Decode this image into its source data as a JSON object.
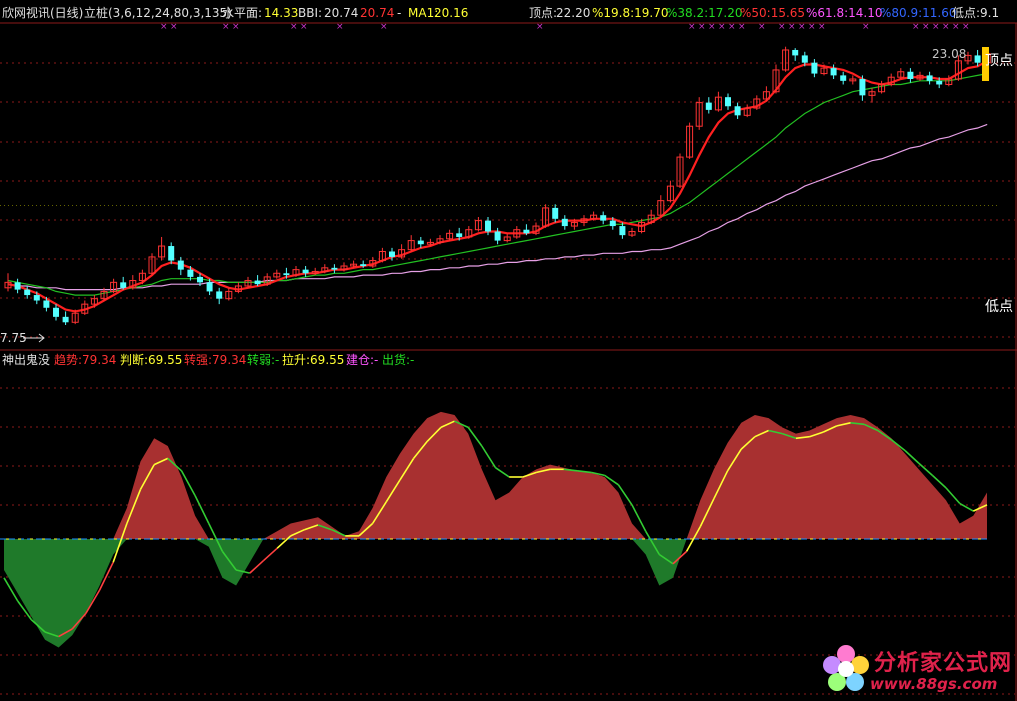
{
  "header_main": {
    "title": "欣网视讯(日线)",
    "indicator": "立桩(3,6,12,24,80,3,135)",
    "level_label": "水平面:",
    "level_value": "14.33",
    "bbi_label": "BBI:",
    "bbi_value": "20.74",
    "bbi_value2": "20.74",
    "dash": "-",
    "ma_label": "MA1:",
    "ma_value": "20.16",
    "top_label": "顶点:",
    "top_value": "22.20",
    "fib1": "%19.8:19.70",
    "fib2": "%38.2:17.20",
    "fib3": "%50:15.65",
    "fib4": "%61.8:14.10",
    "fib5": "%80.9:11.60",
    "low_label": "低点:",
    "low_value": "9.1"
  },
  "header_sub": {
    "name": "神出鬼没",
    "trend": "趋势:79.34",
    "judge": "判断:69.55",
    "strong": "转强:79.34",
    "weak": "转弱:-",
    "pull": "拉升:69.55",
    "build": "建仓:-",
    "ship": "出货:-"
  },
  "annotations": {
    "high_price": "23.08",
    "low_price": "7.75",
    "top_mark": "顶点",
    "low_mark": "低点"
  },
  "watermark": {
    "brand": "分析家公式网",
    "url": "www.88gs.com"
  },
  "colors": {
    "up": "#ff3333",
    "down": "#54ffff",
    "ma_short": "#ff2020",
    "ma_mid": "#22c022",
    "ma_long": "#e6a0e6",
    "level": "#ffff00",
    "osc_pos": "#a83030",
    "osc_neg": "#1f7a2a",
    "osc_line": "#ffff33",
    "zero_line": "#1e90ff",
    "grid": "#8b1a1a"
  },
  "chart_data": [
    {
      "type": "candlestick",
      "title": "欣网视讯(日线)",
      "ylim": [
        7.2,
        24.0
      ],
      "candles": [
        [
          9.8,
          10.1,
          10.6,
          9.6
        ],
        [
          10.1,
          9.7,
          10.3,
          9.5
        ],
        [
          9.7,
          9.4,
          9.9,
          9.2
        ],
        [
          9.4,
          9.1,
          9.6,
          8.9
        ],
        [
          9.1,
          8.7,
          9.3,
          8.5
        ],
        [
          8.7,
          8.2,
          8.9,
          8.0
        ],
        [
          8.2,
          7.9,
          8.5,
          7.75
        ],
        [
          7.9,
          8.4,
          8.6,
          7.8
        ],
        [
          8.4,
          8.9,
          9.1,
          8.3
        ],
        [
          8.9,
          9.2,
          9.4,
          8.7
        ],
        [
          9.2,
          9.6,
          9.8,
          9.1
        ],
        [
          9.6,
          10.1,
          10.3,
          9.5
        ],
        [
          10.1,
          9.8,
          10.4,
          9.7
        ],
        [
          9.8,
          10.2,
          10.5,
          9.7
        ],
        [
          10.2,
          10.6,
          10.8,
          10.0
        ],
        [
          10.6,
          11.5,
          11.7,
          10.5
        ],
        [
          11.5,
          12.1,
          12.6,
          11.3
        ],
        [
          12.1,
          11.3,
          12.3,
          11.1
        ],
        [
          11.3,
          10.8,
          11.5,
          10.5
        ],
        [
          10.8,
          10.4,
          11.0,
          10.2
        ],
        [
          10.4,
          10.1,
          10.6,
          9.9
        ],
        [
          10.1,
          9.6,
          10.3,
          9.4
        ],
        [
          9.6,
          9.2,
          9.8,
          8.9
        ],
        [
          9.2,
          9.6,
          9.8,
          9.1
        ],
        [
          9.6,
          9.9,
          10.1,
          9.5
        ],
        [
          9.9,
          10.2,
          10.4,
          9.8
        ],
        [
          10.2,
          10.0,
          10.5,
          9.9
        ],
        [
          10.0,
          10.4,
          10.6,
          9.9
        ],
        [
          10.4,
          10.6,
          10.8,
          10.3
        ],
        [
          10.6,
          10.5,
          10.9,
          10.3
        ],
        [
          10.5,
          10.8,
          11.0,
          10.4
        ],
        [
          10.8,
          10.6,
          11.0,
          10.4
        ],
        [
          10.6,
          10.7,
          10.9,
          10.5
        ],
        [
          10.7,
          10.9,
          11.1,
          10.6
        ],
        [
          10.9,
          10.8,
          11.1,
          10.6
        ],
        [
          10.8,
          11.0,
          11.2,
          10.7
        ],
        [
          11.0,
          11.1,
          11.3,
          10.9
        ],
        [
          11.1,
          11.0,
          11.3,
          10.9
        ],
        [
          11.0,
          11.3,
          11.5,
          10.9
        ],
        [
          11.3,
          11.8,
          12.0,
          11.2
        ],
        [
          11.8,
          11.5,
          12.0,
          11.3
        ],
        [
          11.5,
          11.9,
          12.2,
          11.4
        ],
        [
          11.9,
          12.4,
          12.7,
          11.8
        ],
        [
          12.4,
          12.2,
          12.6,
          12.0
        ],
        [
          12.2,
          12.3,
          12.5,
          12.1
        ],
        [
          12.3,
          12.5,
          12.7,
          12.2
        ],
        [
          12.5,
          12.8,
          13.0,
          12.4
        ],
        [
          12.8,
          12.6,
          13.1,
          12.4
        ],
        [
          12.6,
          13.0,
          13.2,
          12.5
        ],
        [
          13.0,
          13.5,
          13.7,
          12.9
        ],
        [
          13.5,
          12.9,
          13.7,
          12.7
        ],
        [
          12.9,
          12.4,
          13.1,
          12.2
        ],
        [
          12.4,
          12.6,
          12.8,
          12.3
        ],
        [
          12.6,
          13.0,
          13.2,
          12.5
        ],
        [
          13.0,
          12.8,
          13.3,
          12.7
        ],
        [
          12.8,
          13.2,
          13.4,
          12.7
        ],
        [
          13.2,
          14.2,
          14.4,
          13.1
        ],
        [
          14.2,
          13.6,
          14.4,
          13.4
        ],
        [
          13.6,
          13.2,
          13.8,
          13.0
        ],
        [
          13.2,
          13.4,
          13.6,
          13.0
        ],
        [
          13.4,
          13.6,
          13.8,
          13.2
        ],
        [
          13.6,
          13.8,
          14.0,
          13.5
        ],
        [
          13.8,
          13.5,
          14.0,
          13.3
        ],
        [
          13.5,
          13.2,
          13.7,
          13.0
        ],
        [
          13.2,
          12.7,
          13.4,
          12.5
        ],
        [
          12.7,
          12.9,
          13.1,
          12.6
        ],
        [
          12.9,
          13.4,
          13.6,
          12.8
        ],
        [
          13.4,
          13.8,
          14.1,
          13.3
        ],
        [
          13.8,
          14.6,
          14.9,
          13.7
        ],
        [
          14.6,
          15.4,
          15.7,
          14.5
        ],
        [
          15.4,
          17.0,
          17.2,
          15.3
        ],
        [
          17.0,
          18.7,
          18.9,
          16.9
        ],
        [
          18.7,
          20.0,
          20.3,
          18.5
        ],
        [
          20.0,
          19.6,
          20.3,
          19.4
        ],
        [
          19.6,
          20.3,
          20.6,
          19.5
        ],
        [
          20.3,
          19.8,
          20.5,
          19.6
        ],
        [
          19.8,
          19.3,
          20.0,
          19.1
        ],
        [
          19.3,
          19.7,
          19.9,
          19.2
        ],
        [
          19.7,
          20.2,
          20.4,
          19.6
        ],
        [
          20.2,
          20.6,
          20.9,
          20.1
        ],
        [
          20.6,
          21.8,
          22.1,
          20.5
        ],
        [
          21.8,
          22.9,
          23.08,
          21.7
        ],
        [
          22.9,
          22.6,
          23.0,
          22.3
        ],
        [
          22.6,
          22.2,
          22.8,
          22.0
        ],
        [
          22.2,
          21.6,
          22.4,
          21.4
        ],
        [
          21.6,
          21.9,
          22.1,
          21.5
        ],
        [
          21.9,
          21.5,
          22.1,
          21.3
        ],
        [
          21.5,
          21.2,
          21.7,
          21.0
        ],
        [
          21.2,
          21.3,
          21.5,
          21.0
        ],
        [
          21.3,
          20.4,
          21.5,
          20.1
        ],
        [
          20.4,
          20.6,
          20.8,
          20.0
        ],
        [
          20.6,
          21.0,
          21.2,
          20.5
        ],
        [
          21.0,
          21.4,
          21.6,
          20.9
        ],
        [
          21.4,
          21.7,
          21.9,
          21.3
        ],
        [
          21.7,
          21.3,
          21.9,
          21.1
        ],
        [
          21.3,
          21.5,
          21.7,
          21.2
        ],
        [
          21.5,
          21.2,
          21.7,
          21.0
        ],
        [
          21.2,
          21.0,
          21.4,
          20.8
        ],
        [
          21.0,
          21.3,
          21.5,
          20.9
        ],
        [
          21.3,
          22.3,
          22.6,
          21.2
        ],
        [
          22.3,
          22.6,
          22.8,
          22.1
        ],
        [
          22.6,
          22.2,
          22.9,
          22.0
        ],
        [
          22.2,
          22.7,
          23.0,
          22.1
        ]
      ],
      "ma_short": [
        10.0,
        9.9,
        9.7,
        9.5,
        9.2,
        8.9,
        8.6,
        8.5,
        8.6,
        8.8,
        9.1,
        9.4,
        9.7,
        9.9,
        10.1,
        10.5,
        11.0,
        11.2,
        11.1,
        10.9,
        10.6,
        10.3,
        10.0,
        9.8,
        9.7,
        9.8,
        9.9,
        10.0,
        10.2,
        10.4,
        10.5,
        10.6,
        10.6,
        10.7,
        10.8,
        10.8,
        10.9,
        11.0,
        11.1,
        11.3,
        11.5,
        11.6,
        11.8,
        12.0,
        12.1,
        12.3,
        12.4,
        12.5,
        12.6,
        12.8,
        12.9,
        12.9,
        12.8,
        12.8,
        12.8,
        12.9,
        13.2,
        13.4,
        13.5,
        13.5,
        13.5,
        13.6,
        13.6,
        13.6,
        13.4,
        13.3,
        13.2,
        13.4,
        13.7,
        14.2,
        15.0,
        16.0,
        17.1,
        18.1,
        18.9,
        19.4,
        19.6,
        19.7,
        19.8,
        20.1,
        20.7,
        21.4,
        21.9,
        22.1,
        22.1,
        22.0,
        21.9,
        21.8,
        21.6,
        21.3,
        21.1,
        21.0,
        21.1,
        21.3,
        21.4,
        21.4,
        21.4,
        21.3,
        21.3,
        21.6,
        21.9,
        22.0,
        22.3
      ],
      "ma_mid": [
        10.2,
        10.1,
        10.0,
        9.9,
        9.8,
        9.6,
        9.5,
        9.4,
        9.4,
        9.4,
        9.5,
        9.6,
        9.7,
        9.8,
        9.9,
        10.0,
        10.2,
        10.3,
        10.3,
        10.3,
        10.3,
        10.2,
        10.2,
        10.1,
        10.1,
        10.1,
        10.1,
        10.1,
        10.2,
        10.2,
        10.3,
        10.4,
        10.5,
        10.5,
        10.6,
        10.6,
        10.7,
        10.8,
        10.8,
        10.9,
        11.0,
        11.1,
        11.2,
        11.3,
        11.4,
        11.5,
        11.6,
        11.7,
        11.8,
        11.9,
        12.0,
        12.1,
        12.2,
        12.3,
        12.4,
        12.5,
        12.6,
        12.7,
        12.8,
        12.9,
        13.0,
        13.1,
        13.2,
        13.3,
        13.3,
        13.4,
        13.5,
        13.6,
        13.7,
        13.9,
        14.2,
        14.5,
        14.9,
        15.3,
        15.7,
        16.1,
        16.5,
        16.9,
        17.3,
        17.7,
        18.1,
        18.6,
        19.0,
        19.4,
        19.7,
        20.0,
        20.2,
        20.4,
        20.6,
        20.7,
        20.8,
        20.9,
        21.0,
        21.0,
        21.1,
        21.2,
        21.2,
        21.2,
        21.2,
        21.3,
        21.4,
        21.5,
        21.6
      ],
      "ma_long": [
        10.0,
        9.9,
        9.9,
        9.8,
        9.8,
        9.8,
        9.7,
        9.7,
        9.7,
        9.7,
        9.7,
        9.7,
        9.8,
        9.8,
        9.8,
        9.9,
        9.9,
        10.0,
        10.0,
        10.0,
        10.0,
        10.1,
        10.1,
        10.1,
        10.1,
        10.1,
        10.1,
        10.2,
        10.2,
        10.2,
        10.3,
        10.3,
        10.3,
        10.3,
        10.4,
        10.4,
        10.4,
        10.5,
        10.5,
        10.5,
        10.6,
        10.6,
        10.7,
        10.7,
        10.8,
        10.8,
        10.9,
        10.9,
        11.0,
        11.0,
        11.1,
        11.1,
        11.2,
        11.2,
        11.3,
        11.3,
        11.4,
        11.4,
        11.5,
        11.5,
        11.6,
        11.6,
        11.7,
        11.7,
        11.7,
        11.8,
        11.8,
        11.9,
        11.9,
        12.0,
        12.2,
        12.4,
        12.6,
        12.9,
        13.1,
        13.4,
        13.6,
        13.9,
        14.1,
        14.4,
        14.6,
        14.9,
        15.1,
        15.4,
        15.6,
        15.8,
        16.0,
        16.2,
        16.4,
        16.6,
        16.8,
        16.9,
        17.1,
        17.3,
        17.5,
        17.6,
        17.8,
        18.0,
        18.1,
        18.3,
        18.5,
        18.6,
        18.8
      ],
      "level": [
        14.33
      ]
    },
    {
      "type": "area",
      "title": "神出鬼没",
      "ylim": [
        -75,
        100
      ],
      "values": [
        -20,
        -35,
        -50,
        -65,
        -70,
        -62,
        -48,
        -30,
        -10,
        20,
        50,
        65,
        60,
        40,
        15,
        -5,
        -25,
        -30,
        -15,
        0,
        5,
        10,
        12,
        14,
        8,
        2,
        5,
        20,
        40,
        55,
        68,
        78,
        82,
        80,
        68,
        45,
        25,
        30,
        40,
        45,
        48,
        46,
        44,
        43,
        40,
        30,
        10,
        -10,
        -30,
        -25,
        0,
        25,
        45,
        62,
        75,
        80,
        78,
        72,
        68,
        70,
        74,
        78,
        80,
        78,
        72,
        65,
        55,
        45,
        35,
        25,
        10,
        15,
        30
      ],
      "line": [
        -25,
        -40,
        -52,
        -60,
        -63,
        -58,
        -48,
        -33,
        -15,
        10,
        32,
        48,
        52,
        44,
        28,
        10,
        -8,
        -20,
        -22,
        -14,
        -6,
        2,
        6,
        9,
        6,
        2,
        2,
        10,
        24,
        38,
        52,
        63,
        72,
        76,
        72,
        60,
        46,
        40,
        40,
        43,
        45,
        45,
        44,
        43,
        41,
        35,
        22,
        5,
        -10,
        -16,
        -8,
        8,
        26,
        44,
        58,
        66,
        70,
        68,
        65,
        66,
        69,
        73,
        75,
        74,
        70,
        64,
        57,
        49,
        41,
        33,
        23,
        18,
        22
      ]
    }
  ]
}
